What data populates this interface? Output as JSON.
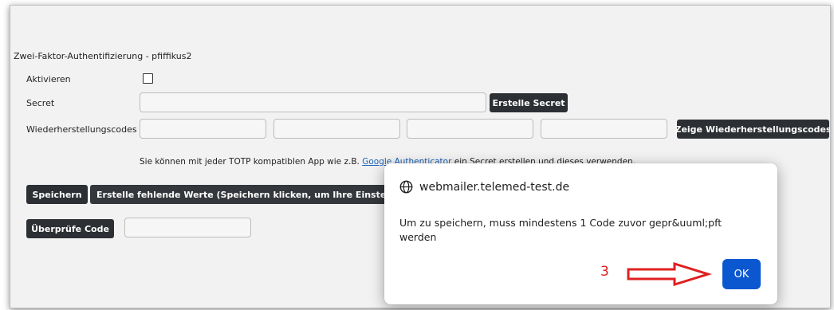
{
  "form": {
    "title": "Zwei-Faktor-Authentifizierung - pfiffikus2",
    "activate_label": "Aktivieren",
    "secret_label": "Secret",
    "create_secret_button": "Erstelle Secret",
    "recovery_codes_label": "Wiederherstellungscodes",
    "show_recovery_codes_button": "Zeige Wiederherstellungscodes",
    "info_text_before_link": "Sie können mit jeder TOTP kompatiblen App wie z.B. ",
    "info_link": "Google Authenticator",
    "info_text_after_link": " ein Secret erstellen und dieses verwenden.",
    "save_button": "Speichern",
    "create_missing_values_button": "Erstelle fehlende Werte (Speichern klicken, um Ihre Einstellungen zu übernehmen)",
    "check_code_button": "Überprüfe Code"
  },
  "dialog": {
    "origin": "webmailer.telemed-test.de",
    "message": "Um zu speichern, muss mindestens 1 Code zuvor gepr&uuml;pft werden",
    "ok_button": "OK",
    "step_number": "3",
    "icon": "globe-icon",
    "arrow_color": "#e02020",
    "ok_color": "#0b57d0"
  }
}
